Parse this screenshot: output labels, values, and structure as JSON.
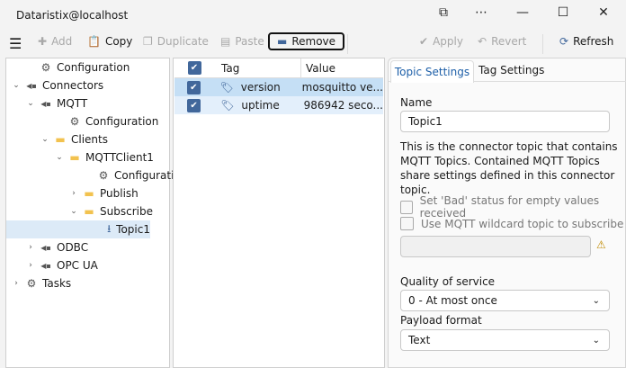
{
  "window": {
    "title": "Dataristix@localhost",
    "icons": [
      "layout-icon",
      "more-icon",
      "minimize-icon",
      "maximize-icon",
      "close-icon"
    ]
  },
  "toolbar": {
    "add": "Add",
    "copy": "Copy",
    "duplicate": "Duplicate",
    "paste": "Paste",
    "remove": "Remove",
    "apply": "Apply",
    "revert": "Revert",
    "refresh": "Refresh"
  },
  "tree": [
    {
      "label": "Configuration",
      "icon": "gear"
    },
    {
      "label": "Connectors",
      "icon": "plug"
    },
    {
      "label": "MQTT",
      "icon": "plug"
    },
    {
      "label": "Configuration",
      "icon": "gear"
    },
    {
      "label": "Clients",
      "icon": "folder"
    },
    {
      "label": "MQTTClient1",
      "icon": "folder"
    },
    {
      "label": "Configuration",
      "icon": "gear"
    },
    {
      "label": "Publish",
      "icon": "folder"
    },
    {
      "label": "Subscribe",
      "icon": "folder"
    },
    {
      "label": "Topic1",
      "icon": "download"
    },
    {
      "label": "ODBC",
      "icon": "plug"
    },
    {
      "label": "OPC UA",
      "icon": "plug"
    },
    {
      "label": "Tasks",
      "icon": "gears"
    }
  ],
  "tags": {
    "headers": {
      "tag": "Tag",
      "value": "Value"
    },
    "rows": [
      {
        "tag": "version",
        "value": "mosquitto ve...",
        "checked": true
      },
      {
        "tag": "uptime",
        "value": "986942 seco...",
        "checked": true
      }
    ]
  },
  "settings": {
    "tabs": [
      "Topic Settings",
      "Tag Settings"
    ],
    "name_label": "Name",
    "name_value": "Topic1",
    "description": "This is the connector topic that contains MQTT Topics. Contained MQTT Topics share settings defined in this connector topic.",
    "bad_status": "Set 'Bad' status for empty values received",
    "wildcard": "Use MQTT wildcard topic to subscribe",
    "wildcard_value": "",
    "qos_label": "Quality of service",
    "qos_value": "0 - At most once",
    "payload_label": "Payload format",
    "payload_value": "Text"
  }
}
